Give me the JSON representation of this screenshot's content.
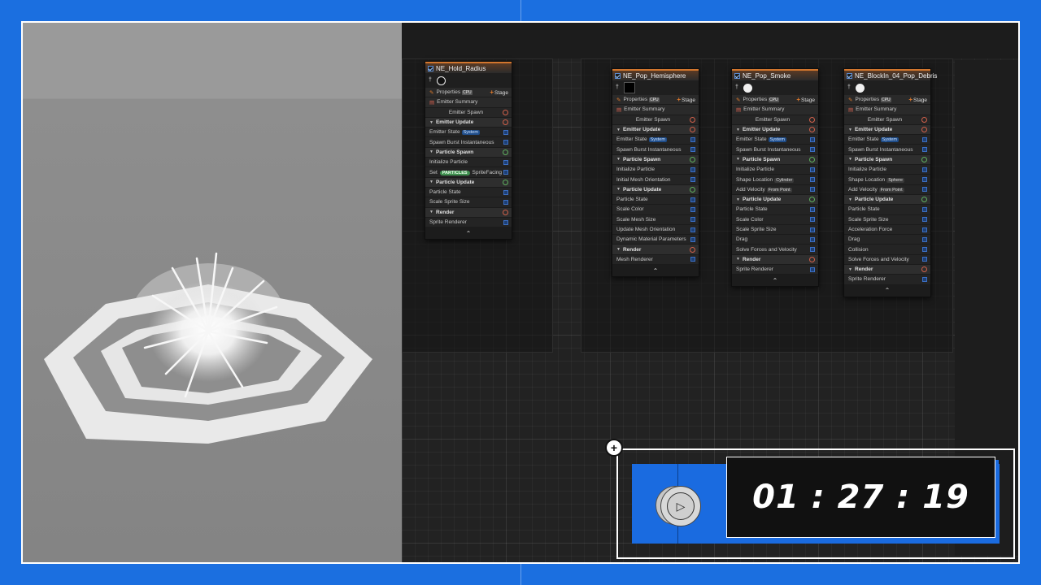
{
  "timer": {
    "value": "01 : 27 : 19"
  },
  "icons": {
    "play": "play-icon",
    "add": "plus-icon"
  },
  "colors": {
    "frame": "#1b6fe0",
    "accent_orange": "#d2762e",
    "check_blue": "#3b6fc4"
  },
  "nodes": [
    {
      "title": "NE_Hold_Radius",
      "properties": "Properties",
      "gpu": "CPU",
      "stage": "Stage",
      "emitter_summary": "Emitter Summary",
      "emitter_spawn": "Emitter Spawn",
      "emitter_update": "Emitter Update",
      "emitter_update_items": [
        {
          "label": "Emitter State",
          "tag": "System"
        },
        {
          "label": "Spawn Burst Instantaneous",
          "tag": ""
        }
      ],
      "particle_spawn": "Particle Spawn",
      "particle_spawn_items": [
        {
          "label": "Initialize Particle",
          "tag": ""
        },
        {
          "label": "Set",
          "pill": "PARTICLES",
          "suffix": "SpriteFacing"
        }
      ],
      "particle_update": "Particle Update",
      "particle_update_items": [
        "Particle State",
        "Scale Sprite Size"
      ],
      "render": "Render",
      "render_items": [
        "Sprite Renderer"
      ]
    },
    {
      "title": "NE_Pop_Hemisphere",
      "properties": "Properties",
      "gpu": "CPU",
      "stage": "Stage",
      "emitter_summary": "Emitter Summary",
      "emitter_spawn": "Emitter Spawn",
      "emitter_update": "Emitter Update",
      "emitter_update_items": [
        {
          "label": "Emitter State",
          "tag": "System"
        },
        {
          "label": "Spawn Burst Instantaneous",
          "tag": ""
        }
      ],
      "particle_spawn": "Particle Spawn",
      "particle_spawn_items": [
        {
          "label": "Initialize Particle",
          "tag": ""
        },
        {
          "label": "Initial Mesh Orientation",
          "tag": ""
        }
      ],
      "particle_update": "Particle Update",
      "particle_update_items": [
        "Particle State",
        "Scale Color",
        "Scale Mesh Size",
        "Update Mesh Orientation",
        "Dynamic Material Parameters"
      ],
      "render": "Render",
      "render_items": [
        "Mesh Renderer"
      ]
    },
    {
      "title": "NE_Pop_Smoke",
      "properties": "Properties",
      "gpu": "CPU",
      "stage": "Stage",
      "emitter_summary": "Emitter Summary",
      "emitter_spawn": "Emitter Spawn",
      "emitter_update": "Emitter Update",
      "emitter_update_items": [
        {
          "label": "Emitter State",
          "tag": "System"
        },
        {
          "label": "Spawn Burst Instantaneous",
          "tag": ""
        }
      ],
      "particle_spawn": "Particle Spawn",
      "particle_spawn_items": [
        {
          "label": "Initialize Particle",
          "tag": ""
        },
        {
          "label": "Shape Location",
          "tag2": "Cylinder"
        },
        {
          "label": "Add Velocity",
          "tag2": "From Point"
        }
      ],
      "particle_update": "Particle Update",
      "particle_update_items": [
        "Particle State",
        "Scale Color",
        "Scale Sprite Size",
        "Drag",
        "Solve Forces and Velocity"
      ],
      "render": "Render",
      "render_items": [
        "Sprite Renderer"
      ]
    },
    {
      "title": "NE_BlockIn_04_Pop_Debris",
      "properties": "Properties",
      "gpu": "CPU",
      "stage": "Stage",
      "emitter_summary": "Emitter Summary",
      "emitter_spawn": "Emitter Spawn",
      "emitter_update": "Emitter Update",
      "emitter_update_items": [
        {
          "label": "Emitter State",
          "tag": "System"
        },
        {
          "label": "Spawn Burst Instantaneous",
          "tag": ""
        }
      ],
      "particle_spawn": "Particle Spawn",
      "particle_spawn_items": [
        {
          "label": "Initialize Particle",
          "tag": ""
        },
        {
          "label": "Shape Location",
          "tag2": "Sphere"
        },
        {
          "label": "Add Velocity",
          "tag2": "From Point"
        }
      ],
      "particle_update": "Particle Update",
      "particle_update_items": [
        "Particle State",
        "Scale Sprite Size",
        "Acceleration Force",
        "Drag",
        "Collision",
        "Solve Forces and Velocity"
      ],
      "render": "Render",
      "render_items": [
        "Sprite Renderer"
      ]
    }
  ]
}
